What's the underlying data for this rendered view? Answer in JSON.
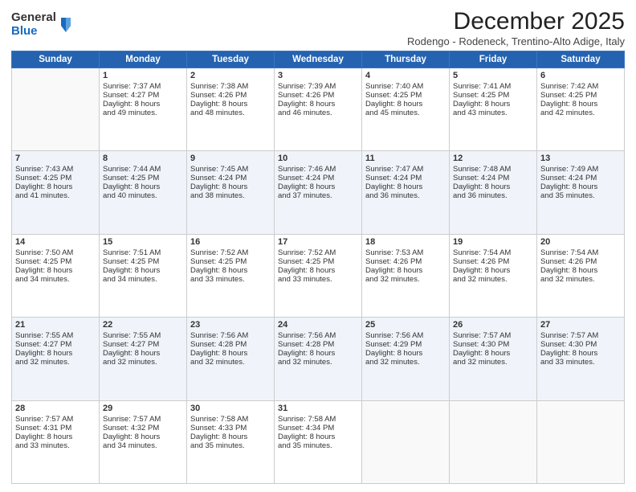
{
  "logo": {
    "general": "General",
    "blue": "Blue"
  },
  "header": {
    "month": "December 2025",
    "subtitle": "Rodengo - Rodeneck, Trentino-Alto Adige, Italy"
  },
  "weekdays": [
    "Sunday",
    "Monday",
    "Tuesday",
    "Wednesday",
    "Thursday",
    "Friday",
    "Saturday"
  ],
  "weeks": [
    [
      {
        "day": "",
        "data": ""
      },
      {
        "day": "1",
        "data": "Sunrise: 7:37 AM\nSunset: 4:27 PM\nDaylight: 8 hours\nand 49 minutes."
      },
      {
        "day": "2",
        "data": "Sunrise: 7:38 AM\nSunset: 4:26 PM\nDaylight: 8 hours\nand 48 minutes."
      },
      {
        "day": "3",
        "data": "Sunrise: 7:39 AM\nSunset: 4:26 PM\nDaylight: 8 hours\nand 46 minutes."
      },
      {
        "day": "4",
        "data": "Sunrise: 7:40 AM\nSunset: 4:25 PM\nDaylight: 8 hours\nand 45 minutes."
      },
      {
        "day": "5",
        "data": "Sunrise: 7:41 AM\nSunset: 4:25 PM\nDaylight: 8 hours\nand 43 minutes."
      },
      {
        "day": "6",
        "data": "Sunrise: 7:42 AM\nSunset: 4:25 PM\nDaylight: 8 hours\nand 42 minutes."
      }
    ],
    [
      {
        "day": "7",
        "data": "Sunrise: 7:43 AM\nSunset: 4:25 PM\nDaylight: 8 hours\nand 41 minutes."
      },
      {
        "day": "8",
        "data": "Sunrise: 7:44 AM\nSunset: 4:25 PM\nDaylight: 8 hours\nand 40 minutes."
      },
      {
        "day": "9",
        "data": "Sunrise: 7:45 AM\nSunset: 4:24 PM\nDaylight: 8 hours\nand 38 minutes."
      },
      {
        "day": "10",
        "data": "Sunrise: 7:46 AM\nSunset: 4:24 PM\nDaylight: 8 hours\nand 37 minutes."
      },
      {
        "day": "11",
        "data": "Sunrise: 7:47 AM\nSunset: 4:24 PM\nDaylight: 8 hours\nand 36 minutes."
      },
      {
        "day": "12",
        "data": "Sunrise: 7:48 AM\nSunset: 4:24 PM\nDaylight: 8 hours\nand 36 minutes."
      },
      {
        "day": "13",
        "data": "Sunrise: 7:49 AM\nSunset: 4:24 PM\nDaylight: 8 hours\nand 35 minutes."
      }
    ],
    [
      {
        "day": "14",
        "data": "Sunrise: 7:50 AM\nSunset: 4:25 PM\nDaylight: 8 hours\nand 34 minutes."
      },
      {
        "day": "15",
        "data": "Sunrise: 7:51 AM\nSunset: 4:25 PM\nDaylight: 8 hours\nand 34 minutes."
      },
      {
        "day": "16",
        "data": "Sunrise: 7:52 AM\nSunset: 4:25 PM\nDaylight: 8 hours\nand 33 minutes."
      },
      {
        "day": "17",
        "data": "Sunrise: 7:52 AM\nSunset: 4:25 PM\nDaylight: 8 hours\nand 33 minutes."
      },
      {
        "day": "18",
        "data": "Sunrise: 7:53 AM\nSunset: 4:26 PM\nDaylight: 8 hours\nand 32 minutes."
      },
      {
        "day": "19",
        "data": "Sunrise: 7:54 AM\nSunset: 4:26 PM\nDaylight: 8 hours\nand 32 minutes."
      },
      {
        "day": "20",
        "data": "Sunrise: 7:54 AM\nSunset: 4:26 PM\nDaylight: 8 hours\nand 32 minutes."
      }
    ],
    [
      {
        "day": "21",
        "data": "Sunrise: 7:55 AM\nSunset: 4:27 PM\nDaylight: 8 hours\nand 32 minutes."
      },
      {
        "day": "22",
        "data": "Sunrise: 7:55 AM\nSunset: 4:27 PM\nDaylight: 8 hours\nand 32 minutes."
      },
      {
        "day": "23",
        "data": "Sunrise: 7:56 AM\nSunset: 4:28 PM\nDaylight: 8 hours\nand 32 minutes."
      },
      {
        "day": "24",
        "data": "Sunrise: 7:56 AM\nSunset: 4:28 PM\nDaylight: 8 hours\nand 32 minutes."
      },
      {
        "day": "25",
        "data": "Sunrise: 7:56 AM\nSunset: 4:29 PM\nDaylight: 8 hours\nand 32 minutes."
      },
      {
        "day": "26",
        "data": "Sunrise: 7:57 AM\nSunset: 4:30 PM\nDaylight: 8 hours\nand 32 minutes."
      },
      {
        "day": "27",
        "data": "Sunrise: 7:57 AM\nSunset: 4:30 PM\nDaylight: 8 hours\nand 33 minutes."
      }
    ],
    [
      {
        "day": "28",
        "data": "Sunrise: 7:57 AM\nSunset: 4:31 PM\nDaylight: 8 hours\nand 33 minutes."
      },
      {
        "day": "29",
        "data": "Sunrise: 7:57 AM\nSunset: 4:32 PM\nDaylight: 8 hours\nand 34 minutes."
      },
      {
        "day": "30",
        "data": "Sunrise: 7:58 AM\nSunset: 4:33 PM\nDaylight: 8 hours\nand 35 minutes."
      },
      {
        "day": "31",
        "data": "Sunrise: 7:58 AM\nSunset: 4:34 PM\nDaylight: 8 hours\nand 35 minutes."
      },
      {
        "day": "",
        "data": ""
      },
      {
        "day": "",
        "data": ""
      },
      {
        "day": "",
        "data": ""
      }
    ]
  ]
}
